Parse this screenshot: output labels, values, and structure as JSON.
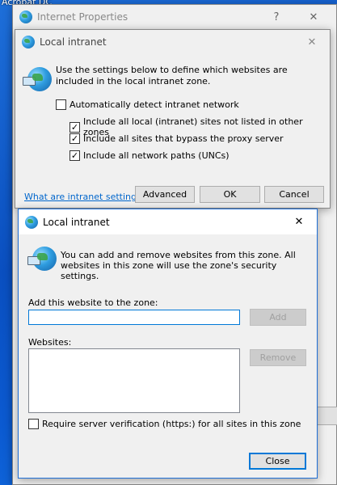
{
  "desktop": {
    "label": "Acrobat DC"
  },
  "internet_properties": {
    "title": "Internet Properties",
    "help_glyph": "?",
    "close_glyph": "✕"
  },
  "intranet_dialog": {
    "title": "Local intranet",
    "close_glyph": "✕",
    "description": "Use the settings below to define which websites are included in the local intranet zone.",
    "checkboxes": [
      {
        "label": "Automatically detect intranet network",
        "checked": false
      },
      {
        "label": "Include all local (intranet) sites not listed in other zones",
        "checked": true
      },
      {
        "label": "Include all sites that bypass the proxy server",
        "checked": true
      },
      {
        "label": "Include all network paths (UNCs)",
        "checked": true
      }
    ],
    "help_link": "What are intranet settings?",
    "advanced_label": "Advanced",
    "ok_label": "OK",
    "cancel_label": "Cancel"
  },
  "sites_dialog": {
    "title": "Local intranet",
    "close_glyph": "✕",
    "description": "You can add and remove websites from this zone. All websites in this zone will use the zone's security settings.",
    "add_label": "Add this website to the zone:",
    "add_value": "",
    "add_button": "Add",
    "websites_label": "Websites:",
    "websites": [],
    "remove_button": "Remove",
    "require_https_label": "Require server verification (https:) for all sites in this zone",
    "require_https_checked": false,
    "close_button": "Close"
  },
  "colors": {
    "desktop_blue": "#0a4fc0",
    "dialog_bg": "#f0f0f0",
    "accent": "#0078d7",
    "link": "#0066cc"
  }
}
